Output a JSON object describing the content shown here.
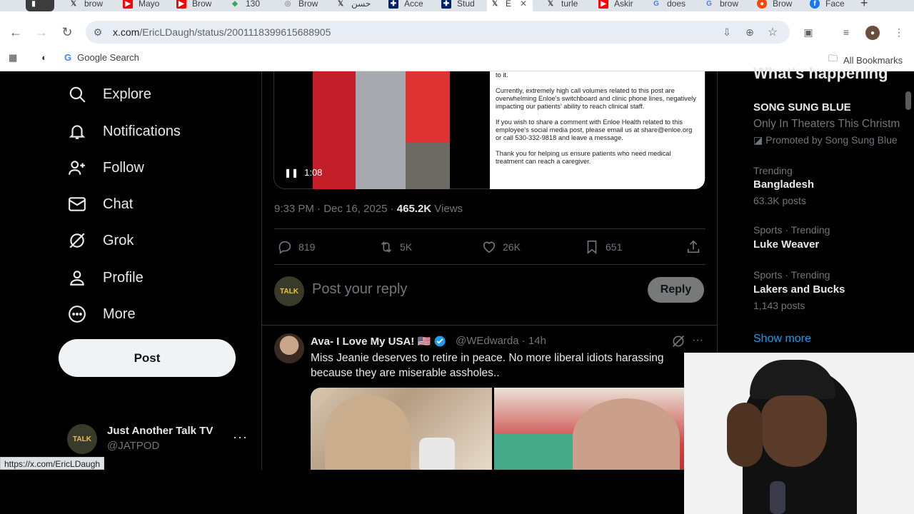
{
  "browser": {
    "tabs": [
      {
        "label": "",
        "icon": "app-icon",
        "color": "#555"
      },
      {
        "label": "brow",
        "icon": "x-logo",
        "color": "#000"
      },
      {
        "label": "Mayo",
        "icon": "youtube-icon",
        "color": "#ff0000"
      },
      {
        "label": "Brow",
        "icon": "youtube-icon",
        "color": "#ff0000"
      },
      {
        "label": "130",
        "icon": "maps-icon",
        "color": "#34a853"
      },
      {
        "label": "Brow",
        "icon": "globe-icon",
        "color": "#999"
      },
      {
        "label": "حسن",
        "icon": "x-logo",
        "color": "#000"
      },
      {
        "label": "Acce",
        "icon": "uk-flag-icon",
        "color": "#c8102e"
      },
      {
        "label": "Stud",
        "icon": "uk-flag-icon",
        "color": "#c8102e"
      },
      {
        "label": "E",
        "icon": "x-logo",
        "color": "#000"
      },
      {
        "label": "turle",
        "icon": "x-logo",
        "color": "#000"
      },
      {
        "label": "Askir",
        "icon": "youtube-icon",
        "color": "#ff0000"
      },
      {
        "label": "does",
        "icon": "google-icon",
        "color": "#4285f4"
      },
      {
        "label": "brow",
        "icon": "google-icon",
        "color": "#4285f4"
      },
      {
        "label": "Brow",
        "icon": "reddit-icon",
        "color": "#ff4500"
      },
      {
        "label": "Face",
        "icon": "facebook-icon",
        "color": "#1877f2"
      }
    ],
    "url_host": "x.com",
    "url_path": "/EricLDaugh/status/2001118399615688905",
    "bookmarks": {
      "google_search": "Google Search",
      "all_bookmarks": "All Bookmarks"
    },
    "status_url": "https://x.com/EricLDaugh"
  },
  "sidebar": {
    "items": [
      {
        "label": "Explore",
        "icon": "search-icon"
      },
      {
        "label": "Notifications",
        "icon": "bell-icon"
      },
      {
        "label": "Follow",
        "icon": "follow-icon"
      },
      {
        "label": "Chat",
        "icon": "mail-icon"
      },
      {
        "label": "Grok",
        "icon": "grok-icon"
      },
      {
        "label": "Profile",
        "icon": "person-icon"
      },
      {
        "label": "More",
        "icon": "more-circle-icon"
      }
    ],
    "post_label": "Post",
    "account": {
      "name": "Just Another Talk TV",
      "handle": "@JATPOD",
      "avatar_text": "TALK"
    }
  },
  "main_post": {
    "video_time": "1:08",
    "notice_paragraphs": [
      "to it.",
      "Currently, extremely high call volumes related to this post are overwhelming Enloe's switchboard and clinic phone lines, negatively impacting our patients' ability to reach clinical staff.",
      "If you wish to share a comment with Enloe Health related to this employee's social media post, please email us at share@enloe.org or call 530-332-9818 and leave a message.",
      "Thank you for helping us ensure patients who need medical treatment can reach a caregiver."
    ],
    "time": "9:33 PM · Dec 16, 2025 · ",
    "views_count": "465.2K",
    "views_label": " Views",
    "stats": {
      "replies": "819",
      "reposts": "5K",
      "likes": "26K",
      "bookmarks": "651"
    }
  },
  "reply_box": {
    "placeholder": "Post your reply",
    "button": "Reply",
    "avatar_text": "TALK"
  },
  "reply_tweet": {
    "name": "Ava- I Love My USA! 🇺🇸",
    "handle": "@WEdwarda · 14h",
    "text": "Miss Jeanie deserves to retire in peace. No more liberal idiots harassing because they are miserable assholes.."
  },
  "right_column": {
    "heading": "What's happening",
    "promo": {
      "title": "SONG SUNG BLUE",
      "subtitle": "Only In Theaters This Christm",
      "promoted": "Promoted by Song Sung Blue"
    },
    "trends": [
      {
        "context": "Trending",
        "title": "Bangladesh",
        "count": "63.3K posts"
      },
      {
        "context": "Sports · Trending",
        "title": "Luke Weaver",
        "count": ""
      },
      {
        "context": "Sports · Trending",
        "title": "Lakers and Bucks",
        "count": "1,143 posts"
      }
    ],
    "show_more": "Show more"
  }
}
